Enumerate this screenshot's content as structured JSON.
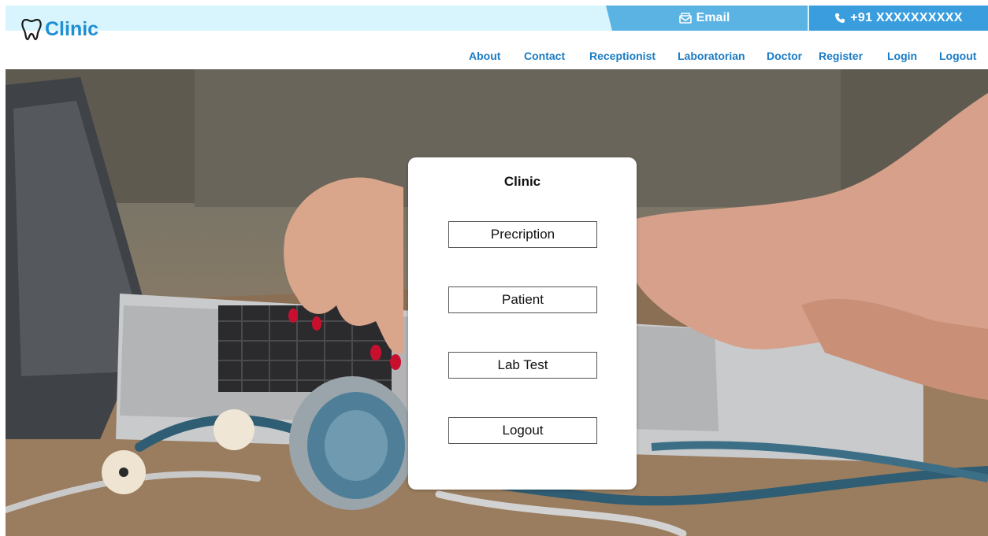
{
  "topbar": {
    "email_label": "Email",
    "email_icon": "envelope-icon",
    "phone_label": "+91 XXXXXXXXXX",
    "phone_icon": "phone-icon",
    "colors": {
      "strip": "#d8f5fd",
      "email_bg": "#5bb3e4",
      "phone_bg": "#3a9ede"
    }
  },
  "header": {
    "brand": "Clinic",
    "brand_icon": "tooth-icon",
    "brand_color": "#1f8ed4",
    "nav": [
      "About",
      "Contact",
      "Receptionist",
      "Laboratorian",
      "Doctor",
      "Register",
      "Login",
      "Logout"
    ]
  },
  "card": {
    "title": "Clinic",
    "buttons": [
      "Precription",
      "Patient",
      "Lab Test",
      "Logout"
    ]
  }
}
